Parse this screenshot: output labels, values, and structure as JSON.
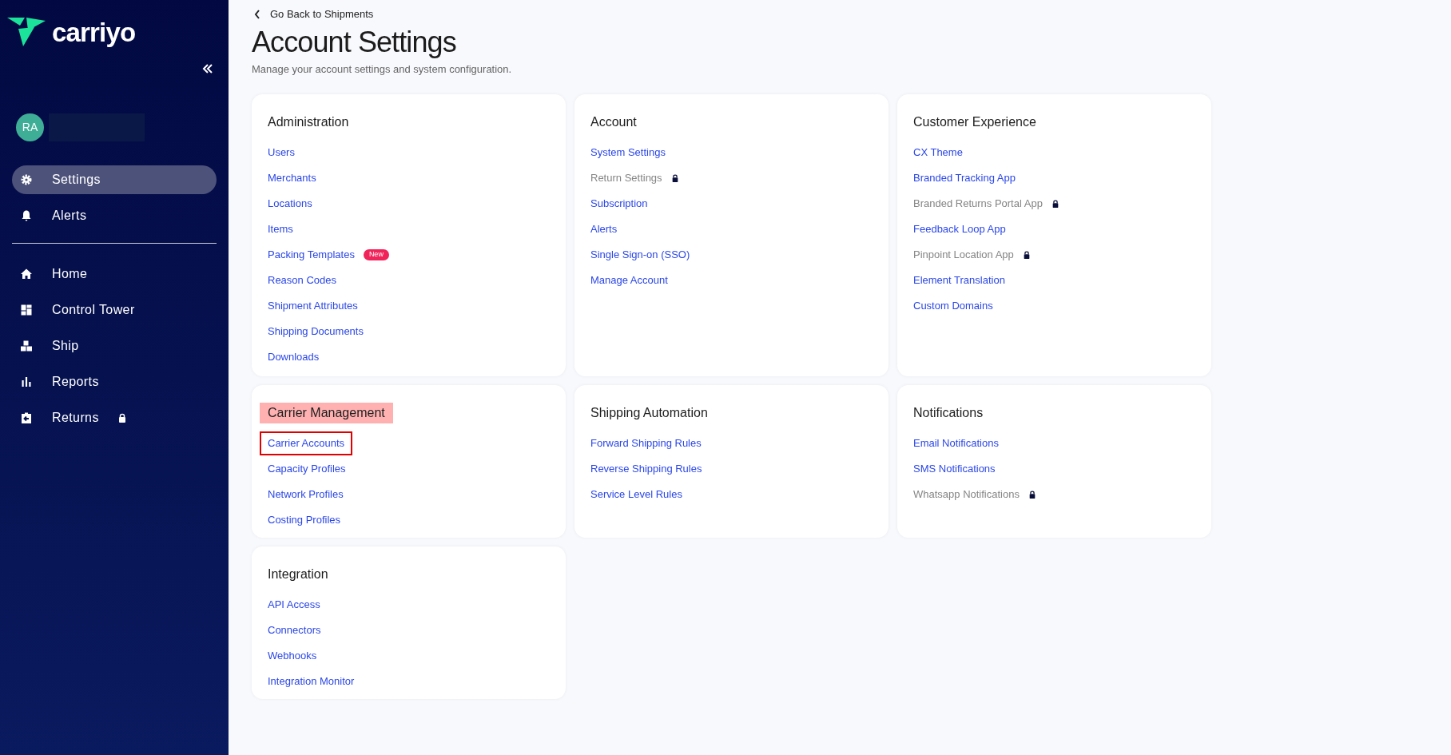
{
  "sidebar": {
    "logo": "carriyo",
    "user": {
      "initials": "RA"
    },
    "top_items": [
      {
        "label": "Settings",
        "kind": "gear",
        "selected": true,
        "locked": false
      },
      {
        "label": "Alerts",
        "kind": "bell",
        "selected": false,
        "locked": false
      }
    ],
    "nav_items": [
      {
        "label": "Home",
        "kind": "home",
        "selected": false,
        "locked": false
      },
      {
        "label": "Control Tower",
        "kind": "dashboard",
        "selected": false,
        "locked": false
      },
      {
        "label": "Ship",
        "kind": "boxes",
        "selected": false,
        "locked": false
      },
      {
        "label": "Reports",
        "kind": "bars",
        "selected": false,
        "locked": false
      },
      {
        "label": "Returns",
        "kind": "return",
        "selected": false,
        "locked": true
      }
    ]
  },
  "back_link": "Go Back to Shipments",
  "title": "Account Settings",
  "subtitle": "Manage your account settings and system configuration.",
  "cards": [
    {
      "title": "Administration",
      "highlighted": false,
      "links": [
        {
          "label": "Users",
          "locked": false,
          "outlined": false
        },
        {
          "label": "Merchants",
          "locked": false,
          "outlined": false
        },
        {
          "label": "Locations",
          "locked": false,
          "outlined": false
        },
        {
          "label": "Items",
          "locked": false,
          "outlined": false
        },
        {
          "label": "Packing Templates",
          "locked": false,
          "outlined": false,
          "badge": "New"
        },
        {
          "label": "Reason Codes",
          "locked": false,
          "outlined": false
        },
        {
          "label": "Shipment Attributes",
          "locked": false,
          "outlined": false
        },
        {
          "label": "Shipping Documents",
          "locked": false,
          "outlined": false
        },
        {
          "label": "Downloads",
          "locked": false,
          "outlined": false
        }
      ]
    },
    {
      "title": "Account",
      "highlighted": false,
      "links": [
        {
          "label": "System Settings",
          "locked": false,
          "outlined": false
        },
        {
          "label": "Return Settings",
          "locked": true,
          "outlined": false
        },
        {
          "label": "Subscription",
          "locked": false,
          "outlined": false
        },
        {
          "label": "Alerts",
          "locked": false,
          "outlined": false
        },
        {
          "label": "Single Sign-on (SSO)",
          "locked": false,
          "outlined": false
        },
        {
          "label": "Manage Account",
          "locked": false,
          "outlined": false
        }
      ]
    },
    {
      "title": "Customer Experience",
      "highlighted": false,
      "links": [
        {
          "label": "CX Theme",
          "locked": false,
          "outlined": false
        },
        {
          "label": "Branded Tracking App",
          "locked": false,
          "outlined": false
        },
        {
          "label": "Branded Returns Portal App",
          "locked": true,
          "outlined": false
        },
        {
          "label": "Feedback Loop App",
          "locked": false,
          "outlined": false
        },
        {
          "label": "Pinpoint Location App",
          "locked": true,
          "outlined": false
        },
        {
          "label": "Element Translation",
          "locked": false,
          "outlined": false
        },
        {
          "label": "Custom Domains",
          "locked": false,
          "outlined": false
        }
      ]
    },
    {
      "title": "Carrier Management",
      "highlighted": true,
      "links": [
        {
          "label": "Carrier Accounts",
          "locked": false,
          "outlined": true
        },
        {
          "label": "Capacity Profiles",
          "locked": false,
          "outlined": false
        },
        {
          "label": "Network Profiles",
          "locked": false,
          "outlined": false
        },
        {
          "label": "Costing Profiles",
          "locked": false,
          "outlined": false
        }
      ]
    },
    {
      "title": "Shipping Automation",
      "highlighted": false,
      "links": [
        {
          "label": "Forward Shipping Rules",
          "locked": false,
          "outlined": false
        },
        {
          "label": "Reverse Shipping Rules",
          "locked": false,
          "outlined": false
        },
        {
          "label": "Service Level Rules",
          "locked": false,
          "outlined": false
        }
      ]
    },
    {
      "title": "Notifications",
      "highlighted": false,
      "links": [
        {
          "label": "Email Notifications",
          "locked": false,
          "outlined": false
        },
        {
          "label": "SMS Notifications",
          "locked": false,
          "outlined": false
        },
        {
          "label": "Whatsapp Notifications",
          "locked": true,
          "outlined": false
        }
      ]
    },
    {
      "title": "Integration",
      "highlighted": false,
      "links": [
        {
          "label": "API Access",
          "locked": false,
          "outlined": false
        },
        {
          "label": "Connectors",
          "locked": false,
          "outlined": false
        },
        {
          "label": "Webhooks",
          "locked": false,
          "outlined": false
        },
        {
          "label": "Integration Monitor",
          "locked": false,
          "outlined": false
        }
      ]
    }
  ]
}
